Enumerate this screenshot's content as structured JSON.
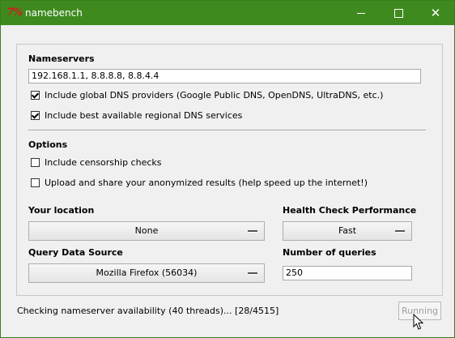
{
  "window": {
    "title": "namebench",
    "icon_glyph": "7%",
    "icon": "namebench-app-icon",
    "controls": {
      "minimize": "minimize-icon",
      "maximize": "maximize-icon",
      "close": "close-icon"
    }
  },
  "nameservers": {
    "heading": "Nameservers",
    "value": "192.168.1.1, 8.8.8.8, 8.8.4.4",
    "include_global_label": "Include global DNS providers (Google Public DNS, OpenDNS, UltraDNS, etc.)",
    "include_global_checked": true,
    "include_regional_label": "Include best available regional DNS services",
    "include_regional_checked": true
  },
  "options": {
    "heading": "Options",
    "censorship_label": "Include censorship checks",
    "censorship_checked": false,
    "upload_label": "Upload and share your anonymized results (help speed up the internet!)",
    "upload_checked": false
  },
  "location": {
    "label": "Your location",
    "selected": "None"
  },
  "health": {
    "label": "Health Check Performance",
    "selected": "Fast"
  },
  "query_source": {
    "label": "Query Data Source",
    "selected": "Mozilla Firefox (56034)"
  },
  "queries": {
    "label": "Number of queries",
    "value": "250"
  },
  "status": {
    "text": "Checking nameserver availability (40 threads)... [28/4515]",
    "button_label": "Running"
  },
  "colors": {
    "titlebar": "#3f8a1f",
    "panel": "#f0f0f0",
    "disabled_text": "#a0a0a0"
  }
}
